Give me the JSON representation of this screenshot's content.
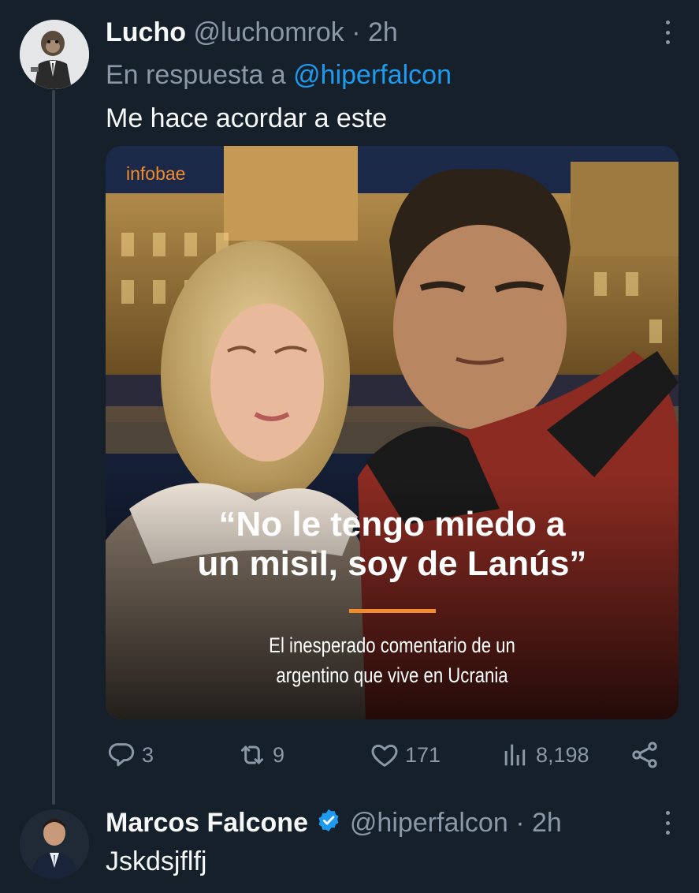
{
  "tweet": {
    "author_name": "Lucho",
    "author_handle": "@luchomrok",
    "separator": "·",
    "time": "2h",
    "reply_prefix": "En respuesta a",
    "reply_handle": "@hiperfalcon",
    "text": "Me hace acordar a este",
    "media": {
      "source_logo": "infobae",
      "headline_line1": "“No le tengo miedo a",
      "headline_line2": "un misil, soy de Lanús”",
      "subhead_line1": "El inesperado comentario de un",
      "subhead_line2": "argentino que vive en Ucrania",
      "accent_color": "#f08c2c"
    },
    "actions": {
      "replies": "3",
      "retweets": "9",
      "likes": "171",
      "views": "8,198"
    }
  },
  "reply": {
    "author_name": "Marcos Falcone",
    "verified": true,
    "author_handle": "@hiperfalcon",
    "separator": "·",
    "time": "2h",
    "text": "Jskdsjflfj"
  },
  "colors": {
    "background": "#15202b",
    "text_primary": "#f7f9f9",
    "text_secondary": "#8b98a5",
    "link": "#1d9bf0"
  }
}
